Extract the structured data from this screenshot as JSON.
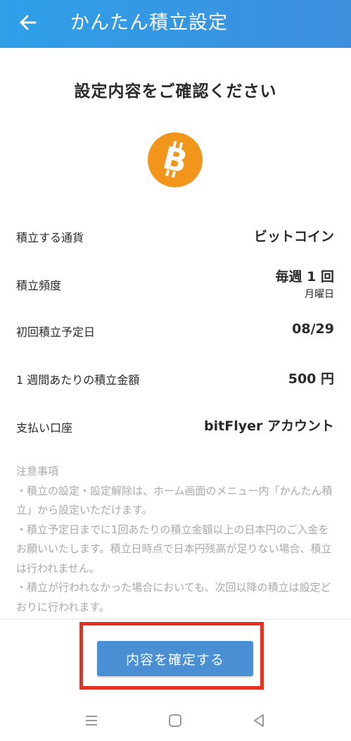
{
  "header": {
    "title": "かんたん積立設定",
    "back_icon": "arrow-left-icon"
  },
  "confirm": {
    "heading": "設定内容をご確認ください",
    "coin_icon": "bitcoin-icon",
    "coin_color": "#f2961b"
  },
  "details": {
    "currency": {
      "label": "積立する通貨",
      "value": "ビットコイン"
    },
    "frequency": {
      "label": "積立頻度",
      "value": "毎週 1 回",
      "sub": "月曜日"
    },
    "first_date": {
      "label": "初回積立予定日",
      "value": "08/29"
    },
    "amount": {
      "label": "1 週間あたりの積立金額",
      "value": "500 円"
    },
    "payment": {
      "label": "支払い口座",
      "value": "bitFlyer アカウント"
    }
  },
  "notes": {
    "title": "注意事項",
    "items": [
      "・積立の設定・設定解除は、ホーム画面のメニュー内「かんたん積立」から設定いただけます。",
      "・積立予定日までに1回あたりの積立金額以上の日本円のご入金をお願いいたします。積立日時点で日本円残高が足りない場合、積立は行われません。",
      "・積立が行われなかった場合においても、次回以降の積立は設定どおりに行われます。"
    ]
  },
  "action": {
    "confirm_label": "内容を確定する",
    "button_color": "#4a8fd4",
    "highlight_color": "#e3321f"
  },
  "system_nav": {
    "menu_icon": "menu-icon",
    "home_icon": "home-square-icon",
    "back_icon": "back-triangle-icon"
  },
  "theme": {
    "header_color": "#3a98e4"
  }
}
